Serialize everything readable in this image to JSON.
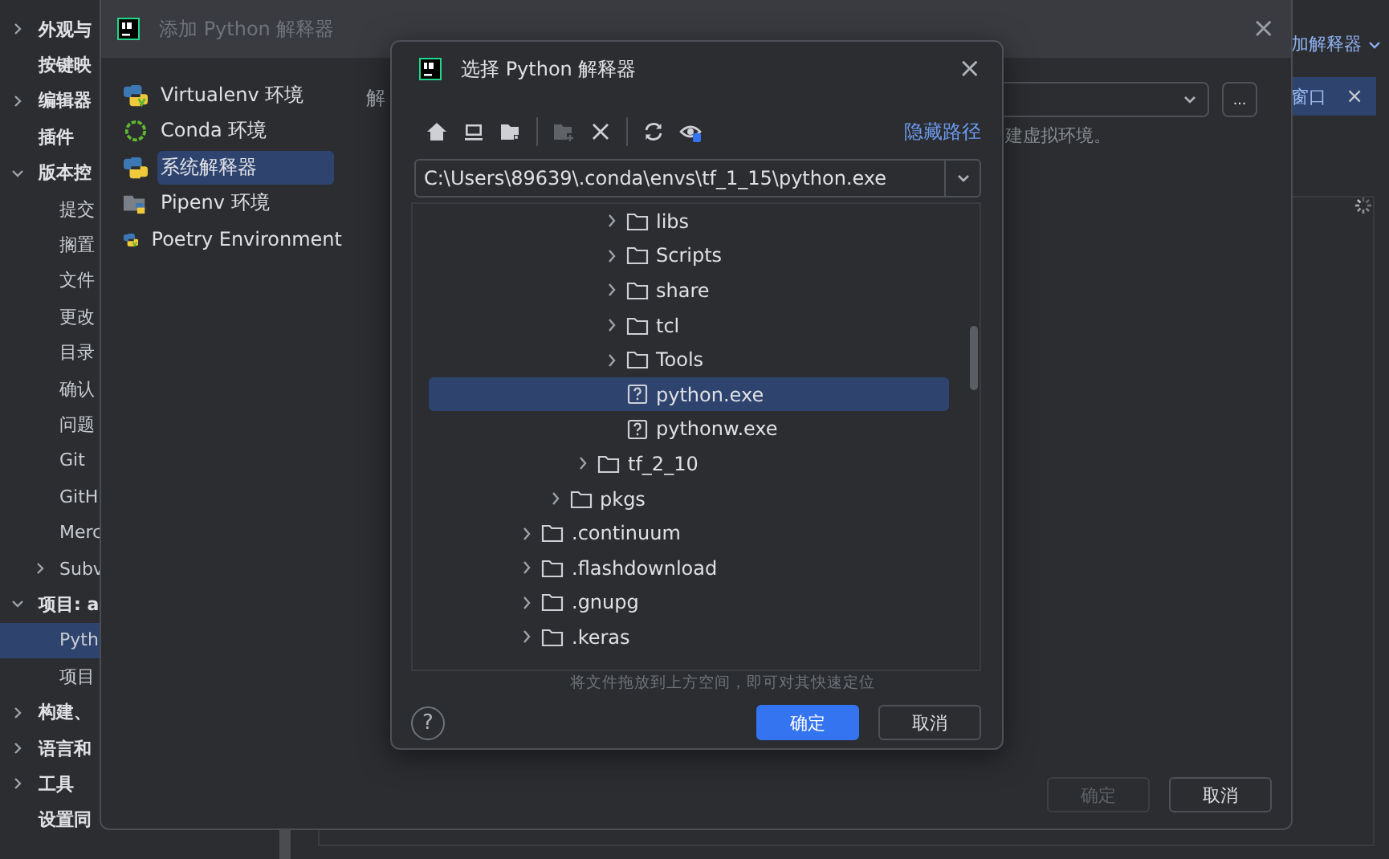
{
  "settings": {
    "sidebar": [
      {
        "label": "外观与",
        "kind": "group",
        "expanded": false
      },
      {
        "label": "按键映",
        "kind": "plain"
      },
      {
        "label": "编辑器",
        "kind": "group",
        "expanded": false
      },
      {
        "label": "插件",
        "kind": "plain"
      },
      {
        "label": "版本控",
        "kind": "group",
        "expanded": true,
        "children": [
          {
            "label": "提交"
          },
          {
            "label": "搁置"
          },
          {
            "label": "文件"
          },
          {
            "label": "更改"
          },
          {
            "label": "目录"
          },
          {
            "label": "确认"
          },
          {
            "label": "问题"
          },
          {
            "label": "Git"
          },
          {
            "label": "GitH"
          },
          {
            "label": "Merc"
          },
          {
            "label": "Subv",
            "expandable": true
          }
        ]
      },
      {
        "label": "项目: a",
        "kind": "group",
        "expanded": true,
        "children": [
          {
            "label": "Pyth",
            "selected": true
          },
          {
            "label": "项目",
            "selected": false
          }
        ]
      },
      {
        "label": "构建、",
        "kind": "group",
        "expanded": false
      },
      {
        "label": "语言和",
        "kind": "group",
        "expanded": false
      },
      {
        "label": "工具",
        "kind": "group",
        "expanded": false
      },
      {
        "label": "设置同",
        "kind": "plain"
      }
    ],
    "add_interpreter_link": "加解释器",
    "tool_tab": {
      "label": "窗口",
      "close": "×"
    }
  },
  "add_dialog": {
    "title": "添加 Python 解释器",
    "close": "×",
    "environments": [
      {
        "label": "Virtualenv 环境",
        "kind": "virtualenv",
        "selected": false
      },
      {
        "label": "Conda 环境",
        "kind": "conda",
        "selected": false
      },
      {
        "label": "系统解释器",
        "kind": "system",
        "selected": true
      },
      {
        "label": "Pipenv 环境",
        "kind": "pipenv",
        "selected": false
      },
      {
        "label": "Poetry Environment",
        "kind": "poetry",
        "selected": false
      }
    ],
    "field_label": "解",
    "browse_button": "...",
    "hint": "建虚拟环境。",
    "buttons": [
      {
        "label": "确定",
        "disabled": true
      },
      {
        "label": "取消",
        "disabled": false
      }
    ]
  },
  "file_dialog": {
    "title": "选择 Python 解释器",
    "close": "×",
    "toolbar": [
      {
        "kind": "home",
        "disabled": false
      },
      {
        "kind": "desktop",
        "disabled": false
      },
      {
        "kind": "project",
        "disabled": false
      },
      {
        "kind": "separator"
      },
      {
        "kind": "newfolder",
        "disabled": true
      },
      {
        "kind": "delete",
        "disabled": false
      },
      {
        "kind": "separator"
      },
      {
        "kind": "refresh",
        "disabled": false
      },
      {
        "kind": "hidden",
        "disabled": false
      }
    ],
    "hide_path_link": "隐藏路径",
    "path": "C:\\Users\\89639\\.conda\\envs\\tf_1_15\\python.exe",
    "tree": [
      {
        "children": [
          {
            "children": [
              {
                "children": [
                  {
                    "label": "libs",
                    "kind": "folder",
                    "expanded": false,
                    "selected": false
                  },
                  {
                    "label": "Scripts",
                    "kind": "folder",
                    "expanded": false,
                    "selected": false
                  },
                  {
                    "label": "share",
                    "kind": "folder",
                    "expanded": false,
                    "selected": false
                  },
                  {
                    "label": "tcl",
                    "kind": "folder",
                    "expanded": false,
                    "selected": false
                  },
                  {
                    "label": "Tools",
                    "kind": "folder",
                    "expanded": false,
                    "selected": false
                  },
                  {
                    "label": "python.exe",
                    "kind": "file",
                    "selected": true
                  },
                  {
                    "label": "pythonw.exe",
                    "kind": "file",
                    "selected": false
                  }
                ]
              },
              {
                "label": "tf_2_10",
                "kind": "folder",
                "expanded": false,
                "selected": false
              }
            ]
          },
          {
            "label": "pkgs",
            "kind": "folder",
            "expanded": false,
            "selected": false
          }
        ]
      },
      {
        "label": ".continuum",
        "kind": "folder",
        "expanded": false,
        "selected": false
      },
      {
        "label": ".flashdownload",
        "kind": "folder",
        "expanded": false,
        "selected": false
      },
      {
        "label": ".gnupg",
        "kind": "folder",
        "expanded": false,
        "selected": false
      },
      {
        "label": ".keras",
        "kind": "folder",
        "expanded": false,
        "selected": false
      }
    ],
    "drop_hint": "将文件拖放到上方空间，即可对其快速定位",
    "help": "?",
    "buttons": [
      {
        "label": "确定",
        "primary": true
      },
      {
        "label": "取消",
        "primary": false
      }
    ]
  }
}
